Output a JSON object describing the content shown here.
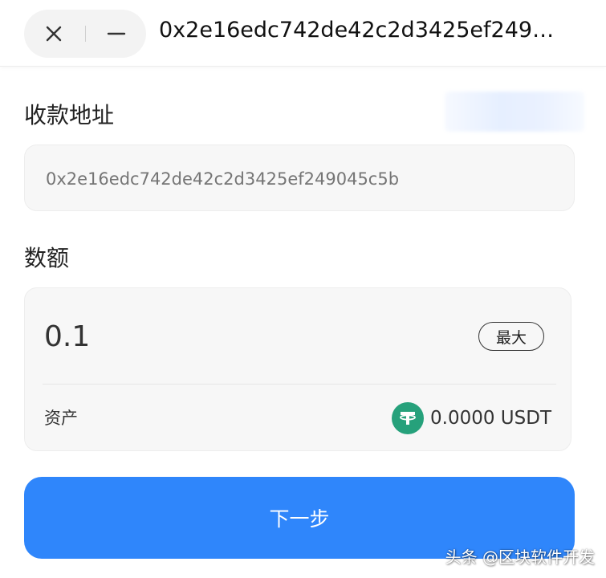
{
  "header": {
    "title": "0x2e16edc742de42c2d3425ef249…",
    "close_icon": "close-icon",
    "minimize_icon": "minimize-icon"
  },
  "form": {
    "address_label": "收款地址",
    "address_placeholder": "0x2e16edc742de42c2d3425ef249045c5b",
    "amount_label": "数额",
    "amount_value": "0.1",
    "max_label": "最大",
    "asset_label": "资产",
    "asset_icon": "tether-icon",
    "asset_balance": "0.0000 USDT"
  },
  "actions": {
    "next_label": "下一步"
  },
  "watermark": {
    "text": "头条 @区块软件开发"
  },
  "colors": {
    "primary": "#2f86fb",
    "tether": "#26a17b",
    "input_bg": "#f7f7f7"
  }
}
